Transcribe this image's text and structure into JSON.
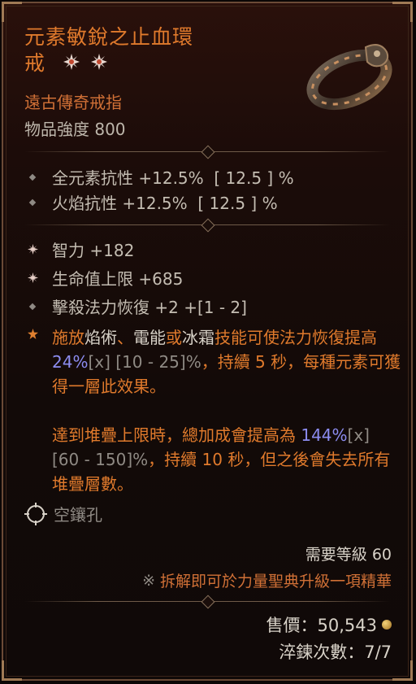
{
  "item": {
    "name_line1": "元素敏銳之止血環",
    "name_line2": "戒",
    "type": "遠古傳奇戒指",
    "power": "物品強度 800",
    "rarity_color": "#e07a2c"
  },
  "implicits": [
    {
      "icon": "diamond-bullet",
      "text": "全元素抗性 +12.5%  [ 12.5 ] %"
    },
    {
      "icon": "diamond-bullet",
      "text": "火焰抗性 +12.5%  [ 12.5 ] %"
    }
  ],
  "affixes": [
    {
      "icon": "greater-affix-icon",
      "text": "智力 +182"
    },
    {
      "icon": "greater-affix-icon",
      "text": "生命值上限 +685"
    },
    {
      "icon": "diamond-bullet",
      "text": "擊殺法力恢復 +2 +[1 - 2]"
    }
  ],
  "legendary": {
    "icon": "legendary-star-icon",
    "p1_a": "施放",
    "p1_b": "焰術",
    "p1_c": "、",
    "p1_d": "電能",
    "p1_e": "或",
    "p1_f": "冰霜",
    "p1_g": "技能可使法力恢復提高 ",
    "p1_val": "24%",
    "p1_x": "[x]",
    "p1_range": " [10 - 25]%",
    "p1_h": "，持續 5 秒，每種元素可獲得一層此效果。",
    "p2_a": "達到堆疊上限時，總加成會提高為 ",
    "p2_val": "144%",
    "p2_x": "[x]",
    "p2_range": " [60 - 150]%",
    "p2_b": "，持續 10 秒，但之後會失去所有堆疊層數。"
  },
  "socket": {
    "label": "空鑲孔",
    "icon": "empty-socket-icon"
  },
  "requirement": "需要等級 60",
  "salvage": {
    "mark": "※",
    "text": "拆解即可於力量聖典升級一項精華"
  },
  "price": {
    "label": "售價：50,543",
    "icon": "gold-coin-icon"
  },
  "tempering": "淬鍊次數：7/7"
}
